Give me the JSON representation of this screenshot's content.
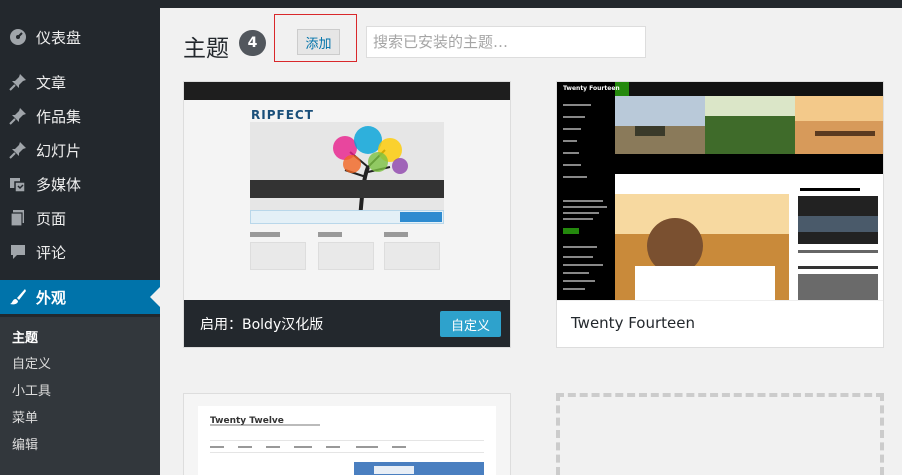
{
  "sidebar": {
    "items": [
      {
        "label": "仪表盘",
        "icon": "dashboard-icon"
      },
      {
        "label": "文章",
        "icon": "pin-icon"
      },
      {
        "label": "作品集",
        "icon": "pin-icon"
      },
      {
        "label": "幻灯片",
        "icon": "pin-icon"
      },
      {
        "label": "多媒体",
        "icon": "media-icon"
      },
      {
        "label": "页面",
        "icon": "page-icon"
      },
      {
        "label": "评论",
        "icon": "comment-icon"
      },
      {
        "label": "外观",
        "icon": "brush-icon"
      }
    ],
    "submenu": [
      "主题",
      "自定义",
      "小工具",
      "菜单",
      "编辑"
    ]
  },
  "header": {
    "title": "主题",
    "count": "4",
    "add_label": "添加",
    "search_placeholder": "搜索已安装的主题…"
  },
  "themes": [
    {
      "active_prefix": "启用：",
      "name": "Boldy汉化版",
      "action": "自定义",
      "logo": "RIPFECT"
    },
    {
      "name": "Twenty Fourteen",
      "site_title": "Twenty Fourteen"
    },
    {
      "name": "Twenty Twelve",
      "site_title": "Twenty Twelve"
    }
  ],
  "colors": {
    "sidebar_bg": "#23282d",
    "active_blue": "#0073aa",
    "customize_blue": "#2ea2cc",
    "highlight_red": "#d9282b"
  }
}
